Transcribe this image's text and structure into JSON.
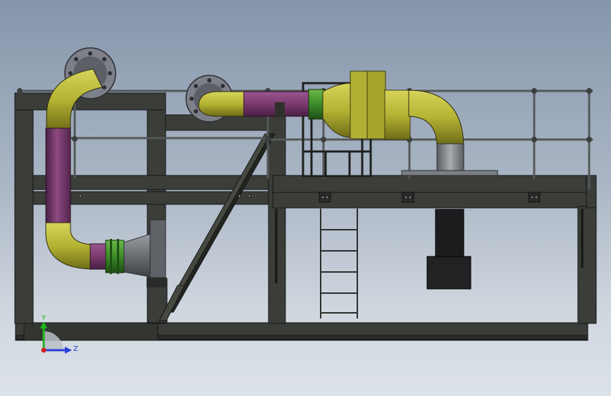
{
  "viewport": {
    "background_top": "#8596ab",
    "background_bottom": "#dce2e8"
  },
  "colors": {
    "steel": "#3a3d38",
    "steel_dark": "#1f211e",
    "pipe_yellow": "#b9b83a",
    "pipe_purple": "#7a3a6e",
    "pipe_green": "#3d8a2a",
    "reducer_grey": "#6b6e72",
    "flange_grey": "#7d8088",
    "handrail": "#55585a"
  },
  "triad": {
    "y_label": "Y",
    "z_label": "Z",
    "y_color": "#1fb51f",
    "z_color": "#2a3fd8",
    "origin_color": "#d42020"
  }
}
